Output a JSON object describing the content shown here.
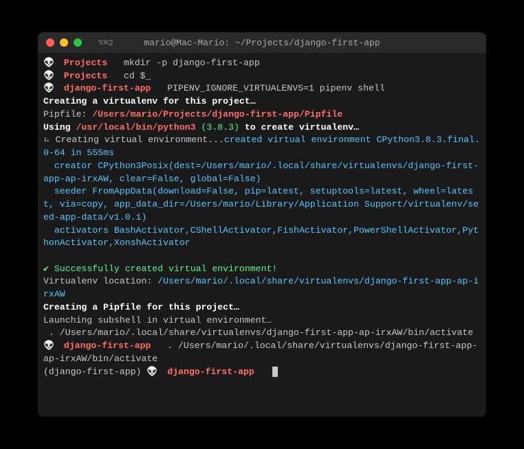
{
  "titlebar": {
    "tab": "⌥⌘2",
    "title": "mario@Mac-Mario: ~/Projects/django-first-app"
  },
  "prompt_icon": "👽",
  "lines": {
    "p1_dir": "Projects",
    "p1_cmd": "mkdir -p django-first-app",
    "p2_dir": "Projects",
    "p2_cmd": "cd $_",
    "p3_dir": "django-first-app",
    "p3_cmd": "PIPENV_IGNORE_VIRTUALENVS=1 pipenv shell",
    "creating_venv": "Creating a virtualenv for this project…",
    "pipfile_label": "Pipfile: ",
    "pipfile_path": "/Users/mario/Projects/django-first-app/Pipfile",
    "using_label": "Using ",
    "python_path": "/usr/local/bin/python3",
    "python_ver": " (3.8.3) ",
    "using_tail": "to create virtualenv…",
    "spinner": "⠦ Creating virtual environment...",
    "created_msg": "created virtual environment CPython3.8.3.final.0-64 in 555ms",
    "creator": "  creator CPython3Posix(dest=/Users/mario/.local/share/virtualenvs/django-first-app-ap-irxAW, clear=False, global=False)",
    "seeder": "  seeder FromAppData(download=False, pip=latest, setuptools=latest, wheel=latest, via=copy, app_data_dir=/Users/mario/Library/Application Support/virtualenv/seed-app-data/v1.0.1)",
    "activators": "  activators BashActivator,CShellActivator,FishActivator,PowerShellActivator,PythonActivator,XonshActivator",
    "success": "✔ Successfully created virtual environment!",
    "venv_loc_label": "Virtualenv location: ",
    "venv_loc_path": "/Users/mario/.local/share/virtualenvs/django-first-app-ap-irxAW",
    "creating_pipfile": "Creating a Pipfile for this project…",
    "launching": "Launching subshell in virtual environment…",
    "activate_line": " . /Users/mario/.local/share/virtualenvs/django-first-app-ap-irxAW/bin/activate",
    "p4_dir": "django-first-app",
    "p4_cmd": " . /Users/mario/.local/share/virtualenvs/django-first-app-ap-irxAW/bin/activate",
    "p5_prefix": "(django-first-app) ",
    "p5_dir": "django-first-app"
  }
}
